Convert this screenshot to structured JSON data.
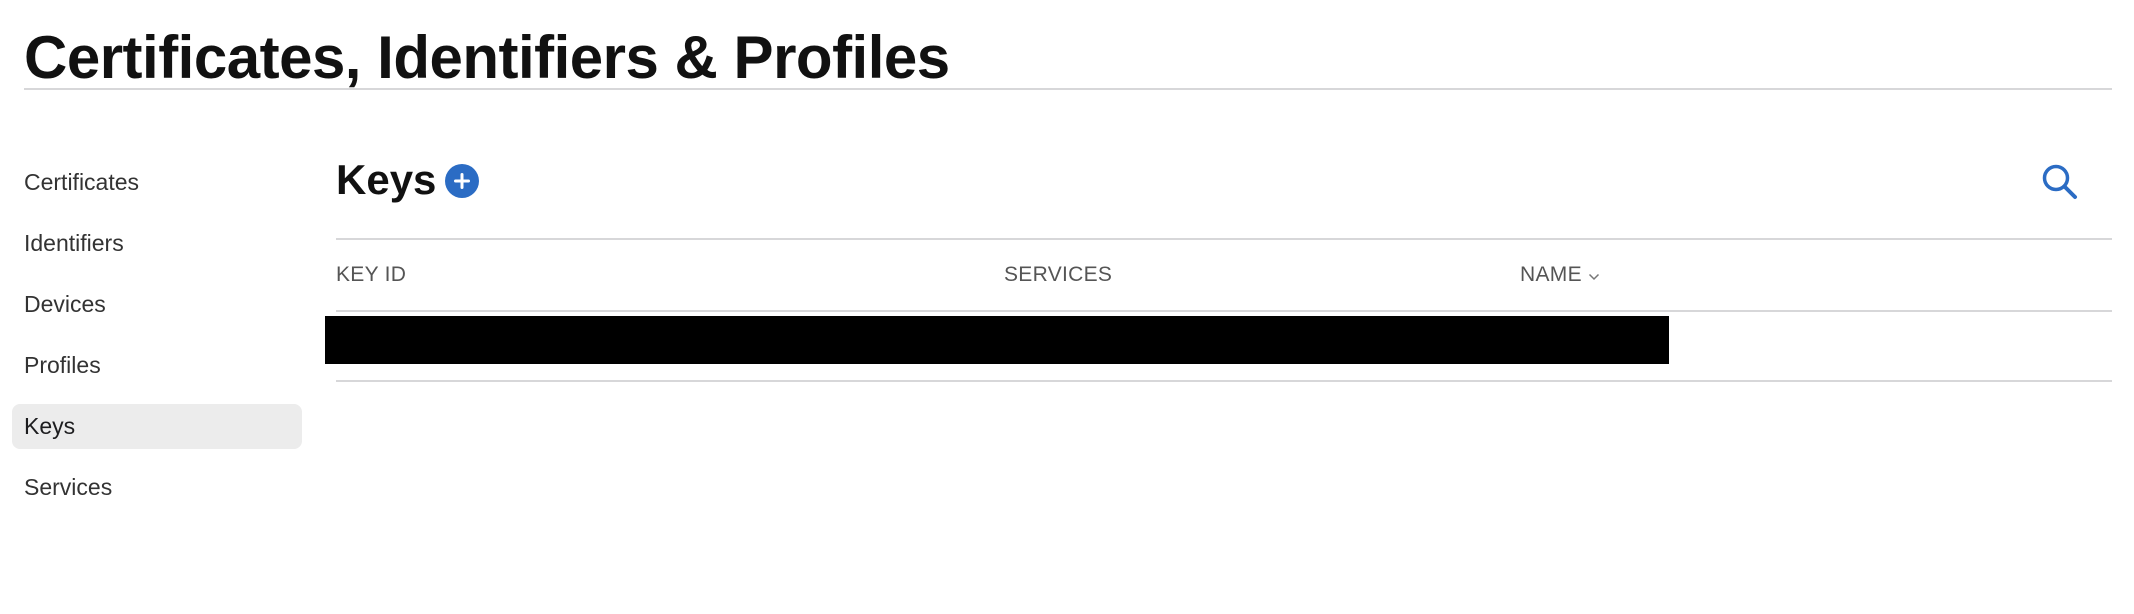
{
  "page": {
    "title": "Certificates, Identifiers & Profiles"
  },
  "sidebar": {
    "items": [
      {
        "label": "Certificates",
        "selected": false
      },
      {
        "label": "Identifiers",
        "selected": false
      },
      {
        "label": "Devices",
        "selected": false
      },
      {
        "label": "Profiles",
        "selected": false
      },
      {
        "label": "Keys",
        "selected": true
      },
      {
        "label": "Services",
        "selected": false
      }
    ]
  },
  "main": {
    "section_title": "Keys",
    "add_icon": "plus-circle-icon",
    "search_icon": "magnifying-glass-icon",
    "table": {
      "columns": [
        {
          "label": "KEY ID"
        },
        {
          "label": "SERVICES"
        },
        {
          "label": "NAME",
          "sort_icon": "chevron-down-icon"
        }
      ],
      "rows": [
        {
          "redacted": true
        }
      ]
    }
  },
  "colors": {
    "accent": "#2b6cc4",
    "selected_background": "#ececec",
    "divider": "#d7d7d9",
    "redaction": "#000000"
  }
}
